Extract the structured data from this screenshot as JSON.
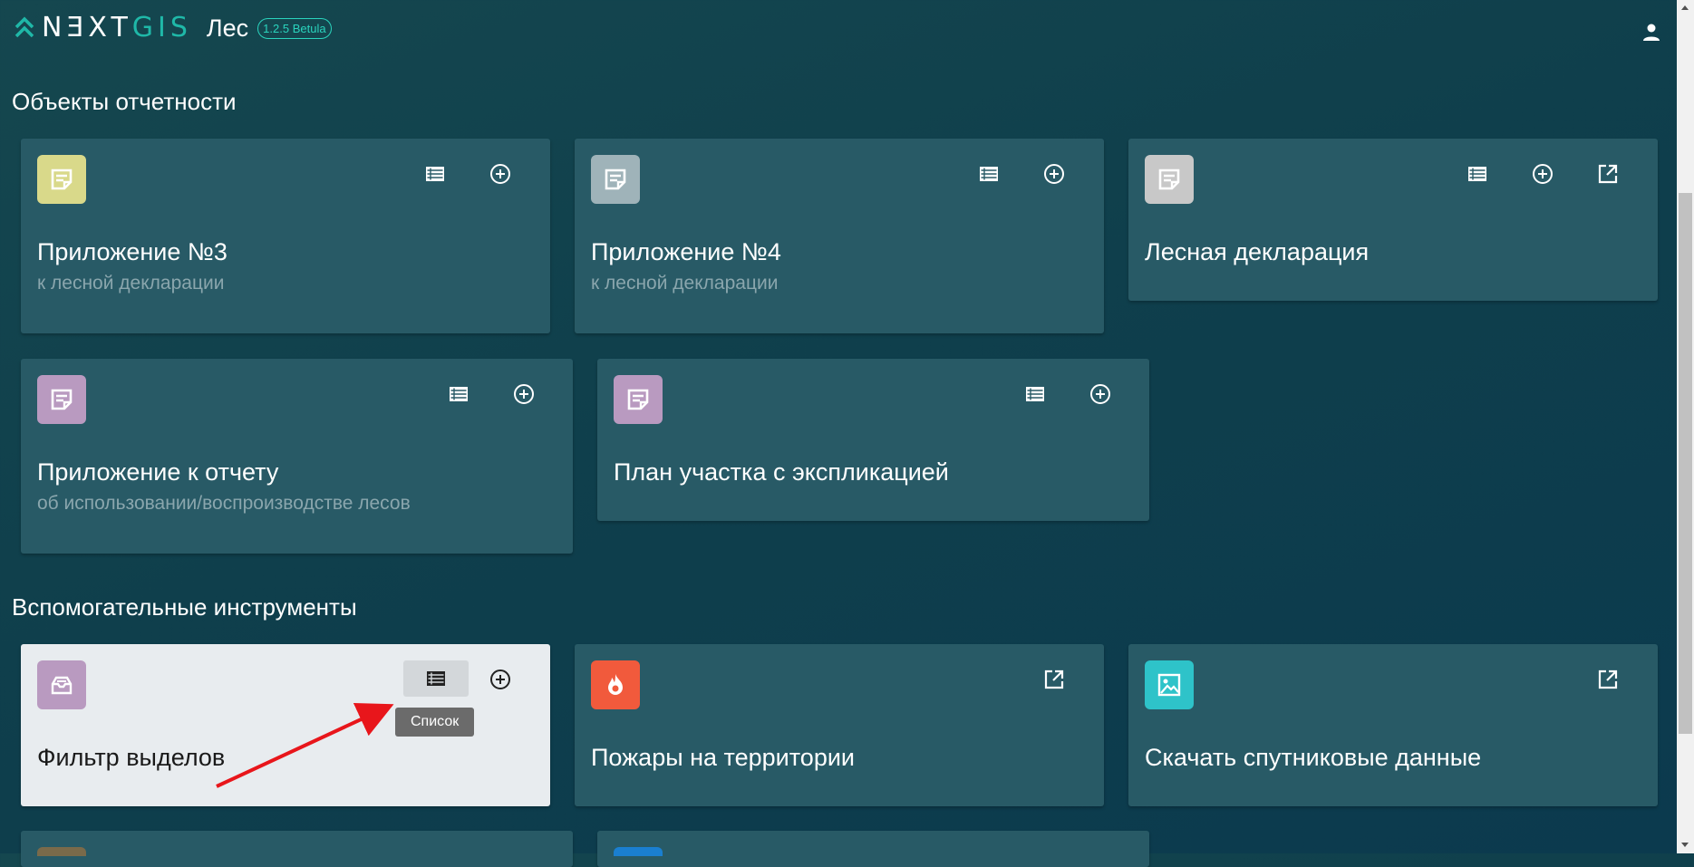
{
  "header": {
    "logo_parts": [
      "N",
      "Ǝ",
      "X",
      "T",
      "GIS"
    ],
    "app_name": "Лес",
    "version": "1.2.5 Betula",
    "user_icon": "person-icon"
  },
  "colors": {
    "accent": "#1fb8a8",
    "background": "#0f3f4c",
    "card": "#285a66",
    "yellow_badge": "#d9d98a",
    "gray_badge": "#9fb3b9",
    "light_gray_badge": "#c8c8c8",
    "purple_badge": "#b99ac0",
    "orange_badge": "#f15a3c",
    "teal_badge": "#2ec3c9"
  },
  "sections": {
    "reporting_title": "Объекты отчетности",
    "tools_title": "Вспомогательные инструменты"
  },
  "cards": {
    "app3": {
      "title": "Приложение №3",
      "subtitle": "к лесной декларации",
      "icon": "document-icon"
    },
    "app4": {
      "title": "Приложение №4",
      "subtitle": "к лесной декларации",
      "icon": "document-icon"
    },
    "declaration": {
      "title": "Лесная декларация",
      "icon": "document-icon"
    },
    "report_app": {
      "title": "Приложение к отчету",
      "subtitle": "об использовании/воспроизводстве лесов",
      "icon": "document-icon"
    },
    "plan": {
      "title": "План участка с экспликацией",
      "icon": "document-icon"
    },
    "filter": {
      "title": "Фильтр выделов",
      "icon": "inbox-icon"
    },
    "fires": {
      "title": "Пожары на территории",
      "icon": "fire-icon"
    },
    "satellite": {
      "title": "Скачать спутниковые данные",
      "icon": "image-icon"
    }
  },
  "tooltip": {
    "text": "Список"
  }
}
